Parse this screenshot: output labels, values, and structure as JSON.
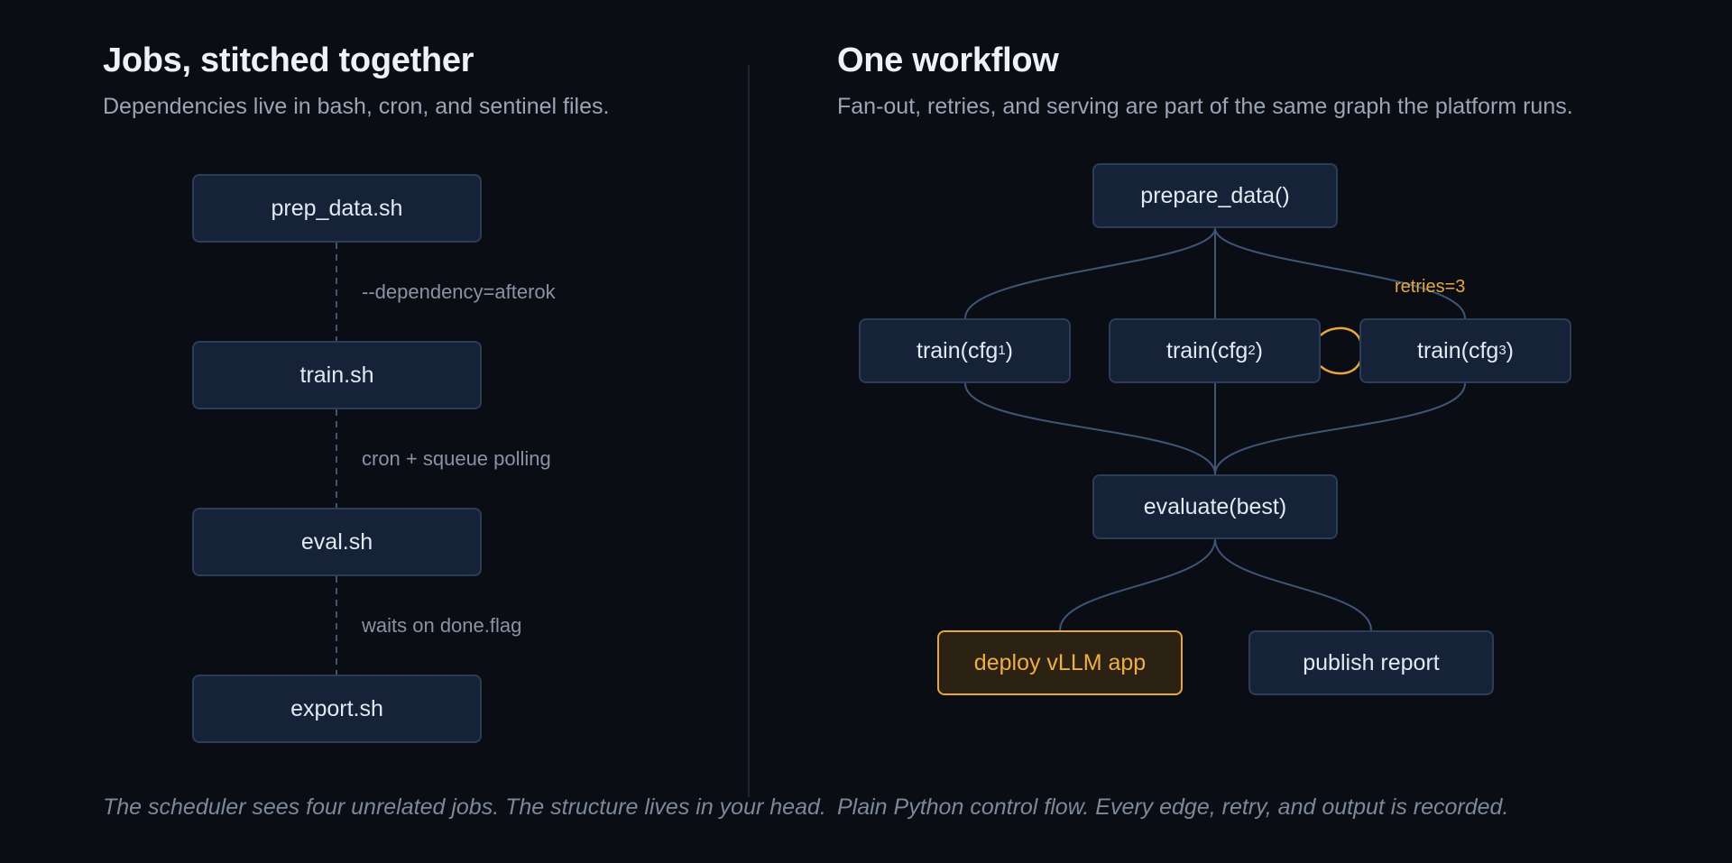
{
  "left": {
    "title": "Jobs, stitched together",
    "subtitle": "Dependencies live in bash, cron, and sentinel files.",
    "nodes": [
      "prep_data.sh",
      "train.sh",
      "eval.sh",
      "export.sh"
    ],
    "edge_labels": [
      "--dependency=afterok",
      "cron + squeue polling",
      "waits on done.flag"
    ],
    "caption": "The scheduler sees four unrelated jobs. The structure lives in your head."
  },
  "right": {
    "title": "One workflow",
    "subtitle": "Fan-out, retries, and serving are part of the same graph the platform runs.",
    "nodes": {
      "prepare": "prepare_data()",
      "train1_prefix": "train(cfg",
      "train1_sub": "1",
      "train1_suffix": ")",
      "train2_prefix": "train(cfg",
      "train2_sub": "2",
      "train2_suffix": ")",
      "train3_prefix": "train(cfg",
      "train3_sub": "3",
      "train3_suffix": ")",
      "evaluate": "evaluate(best)",
      "deploy": "deploy vLLM app",
      "publish": "publish report"
    },
    "retry_label": "retries=3",
    "caption": "Plain Python control flow. Every edge, retry, and output is recorded."
  },
  "colors": {
    "background": "#0a0d14",
    "node_fill": "#162238",
    "node_border": "#2c3d5a",
    "accent": "#e8a640",
    "edge": "#3f5576"
  }
}
